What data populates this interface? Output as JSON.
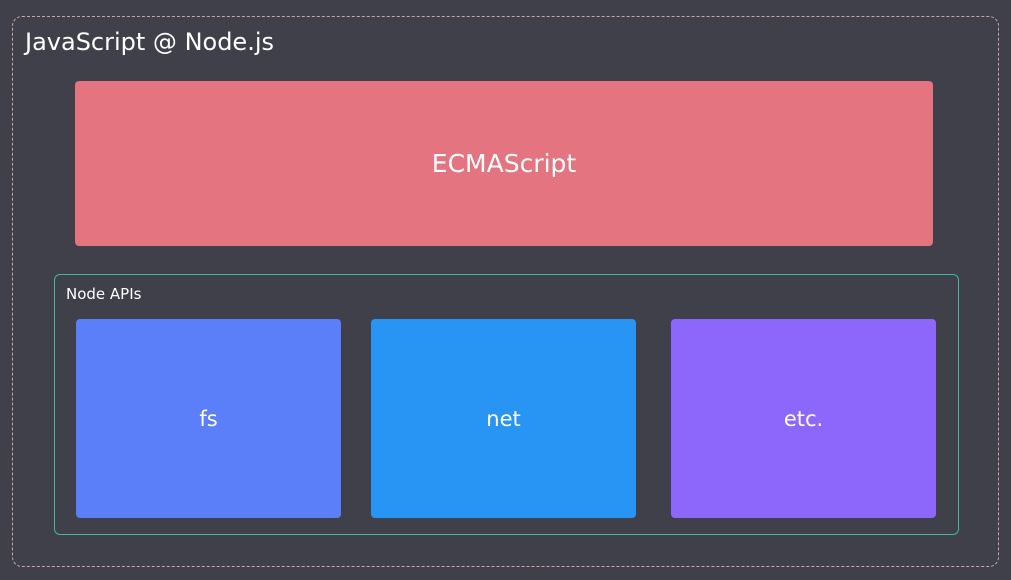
{
  "diagram": {
    "title": "JavaScript @ Node.js",
    "ecmascript_label": "ECMAScript",
    "node_apis": {
      "label": "Node APIs",
      "items": [
        {
          "label": "fs",
          "color": "#5a7ff8"
        },
        {
          "label": "net",
          "color": "#2895f4"
        },
        {
          "label": "etc.",
          "color": "#8d67fc"
        }
      ]
    }
  },
  "colors": {
    "background": "#3f4049",
    "ecmascript_box": "#e47480",
    "node_apis_border": "#3fb7a4",
    "outer_dashed_border": "#c9a7a4",
    "text": "#ffffff"
  }
}
